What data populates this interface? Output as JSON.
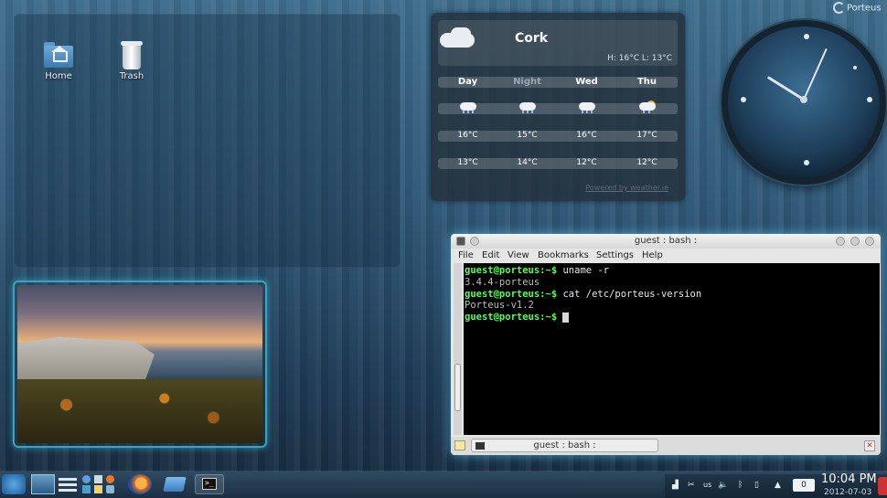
{
  "desktop": {
    "icons": [
      {
        "label": "Home",
        "icon": "home-folder-icon"
      },
      {
        "label": "Trash",
        "icon": "trash-icon"
      }
    ],
    "badge": "Porteus"
  },
  "weather": {
    "city": "Cork",
    "hilo": "H: 16°C  L: 13°C",
    "day_label": "Day",
    "night_label": "Night",
    "days": [
      "Wed",
      "Thu"
    ],
    "highs": [
      "16°C",
      "15°C",
      "16°C",
      "17°C"
    ],
    "lows": [
      "13°C",
      "14°C",
      "12°C",
      "12°C"
    ],
    "powered": "Powered by weather.ie",
    "conditions": [
      "rain",
      "rain",
      "rain",
      "sun-showers"
    ]
  },
  "clock_widget": {
    "hour": 10,
    "minute": 4
  },
  "konsole": {
    "title": "guest : bash :",
    "menu": [
      "File",
      "Edit",
      "View",
      "Bookmarks",
      "Settings",
      "Help"
    ],
    "lines": [
      {
        "prompt": "guest@porteus:~$",
        "cmd": " uname -r"
      },
      {
        "out": "3.4.4-porteus"
      },
      {
        "prompt": "guest@porteus:~$",
        "cmd": " cat /etc/porteus-version"
      },
      {
        "out": "Porteus-v1.2"
      },
      {
        "prompt": "guest@porteus:~$",
        "cmd": " "
      }
    ],
    "tab_label": "guest : bash :"
  },
  "taskbar": {
    "tray_keyboard": "us",
    "tray_counter": "0",
    "time": "10:04 PM",
    "date": "2012-07-03"
  }
}
